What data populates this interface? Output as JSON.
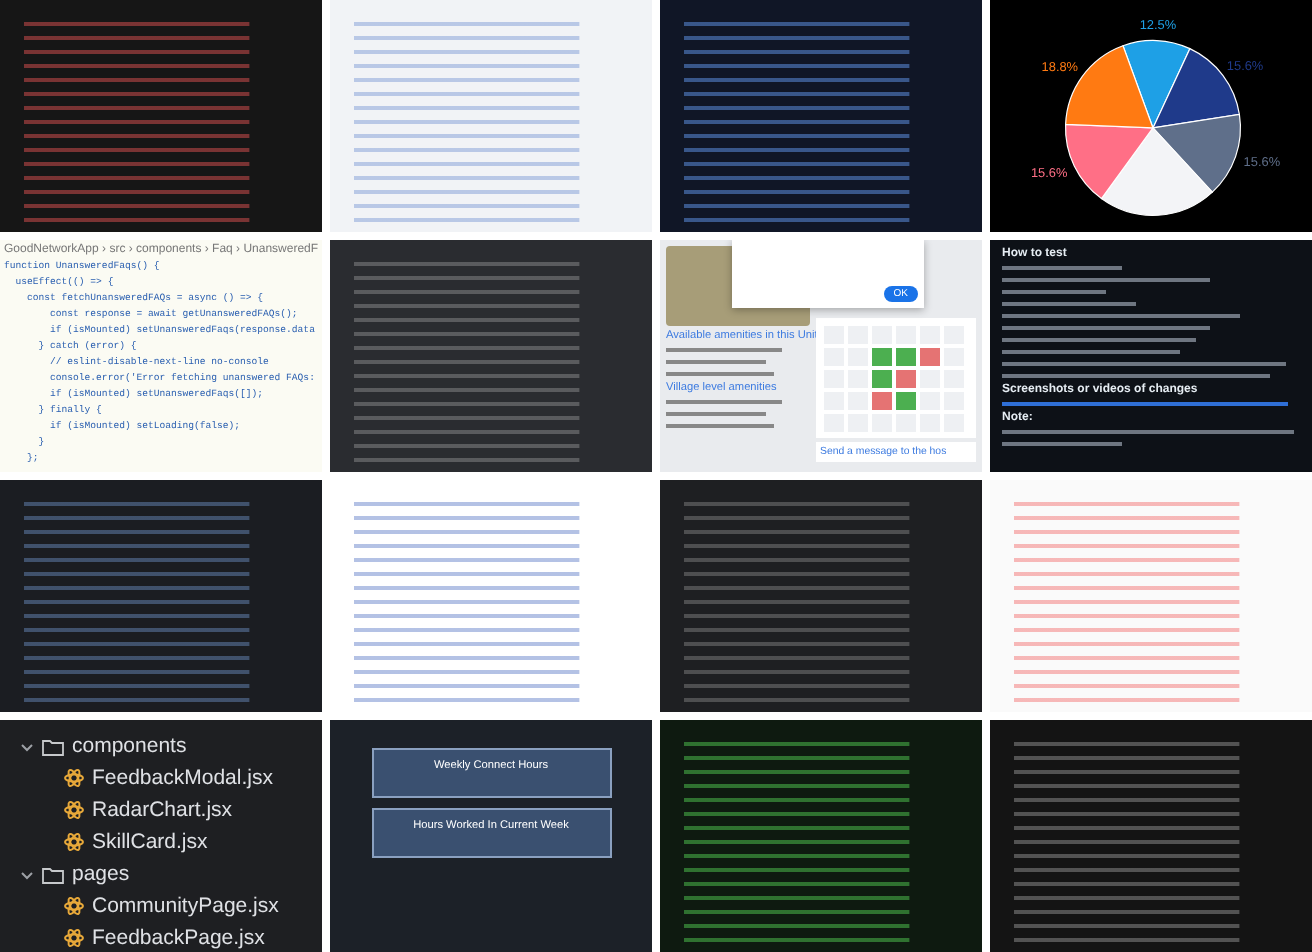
{
  "tiles": [
    {
      "kind": "image"
    },
    {
      "kind": "image"
    },
    {
      "kind": "image"
    },
    {
      "kind": "pie",
      "chart_data": {
        "type": "pie",
        "values": [
          12.5,
          15.6,
          15.6,
          21.9,
          15.6,
          18.8
        ],
        "colors": [
          "#1ea0e6",
          "#1f3a8a",
          "#5f6f8a",
          "#f3f4f7",
          "#ff6f86",
          "#ff7a12"
        ],
        "value_labels": [
          "12.5%",
          "15.6%",
          "15.6%",
          null,
          "15.6%",
          "18.8%"
        ]
      }
    },
    {
      "kind": "code",
      "breadcrumb": "GoodNetworkApp › src › components › Faq › UnansweredF",
      "lines": [
        "function UnansweredFaqs() {",
        "  useEffect(() => {",
        "    const fetchUnansweredFAQs = async () => {",
        "        const response = await getUnansweredFAQs();",
        "        if (isMounted) setUnansweredFaqs(response.data",
        "      } catch (error) {",
        "        // eslint-disable-next-line no-console",
        "        console.error('Error fetching unanswered FAQs:",
        "        if (isMounted) setUnansweredFaqs([]);",
        "      } finally {",
        "        if (isMounted) setLoading(false);",
        "      }",
        "    };"
      ]
    },
    {
      "kind": "image"
    },
    {
      "kind": "page",
      "headings": [
        "Available amenities in this Unit",
        "Village level amenities",
        "Send a message to the hos"
      ],
      "button": "OK"
    },
    {
      "kind": "doc",
      "headings": [
        "How to test",
        "Screenshots or videos of changes",
        "Note:"
      ]
    },
    {
      "kind": "image"
    },
    {
      "kind": "image"
    },
    {
      "kind": "image"
    },
    {
      "kind": "image"
    },
    {
      "kind": "tree",
      "items": [
        {
          "label": "components",
          "kind": "folder",
          "expanded": true,
          "children": [
            {
              "label": "FeedbackModal.jsx",
              "kind": "file"
            },
            {
              "label": "RadarChart.jsx",
              "kind": "file"
            },
            {
              "label": "SkillCard.jsx",
              "kind": "file"
            }
          ]
        },
        {
          "label": "pages",
          "kind": "folder",
          "expanded": true,
          "children": [
            {
              "label": "CommunityPage.jsx",
              "kind": "file"
            },
            {
              "label": "FeedbackPage.jsx",
              "kind": "file"
            }
          ]
        }
      ]
    },
    {
      "kind": "cards",
      "headings": [
        "Weekly Connect Hours",
        "Hours Worked In Current Week"
      ]
    },
    {
      "kind": "image"
    },
    {
      "kind": "image"
    }
  ]
}
